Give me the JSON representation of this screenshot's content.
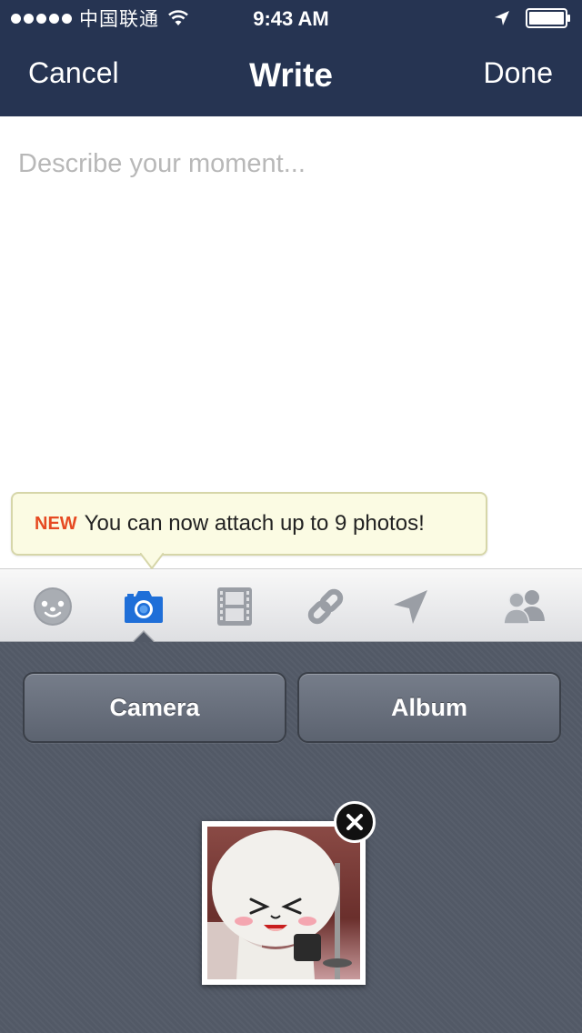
{
  "status_bar": {
    "carrier": "中国联通",
    "time": "9:43 AM"
  },
  "nav": {
    "cancel_label": "Cancel",
    "title": "Write",
    "done_label": "Done"
  },
  "compose": {
    "placeholder": "Describe your moment...",
    "value": ""
  },
  "tooltip": {
    "badge": "NEW",
    "message": "You can now attach up to 9 photos!"
  },
  "toolbar": {
    "tools": [
      "sticker-icon",
      "camera-icon",
      "video-icon",
      "link-icon",
      "location-icon",
      "friends-icon"
    ],
    "active_tool": "camera-icon",
    "active_color": "#1f6fd8"
  },
  "attach_panel": {
    "camera_label": "Camera",
    "album_label": "Album"
  },
  "colors": {
    "nav_background": "#263452",
    "panel_background": "#525966",
    "tooltip_new": "#e64a22"
  }
}
